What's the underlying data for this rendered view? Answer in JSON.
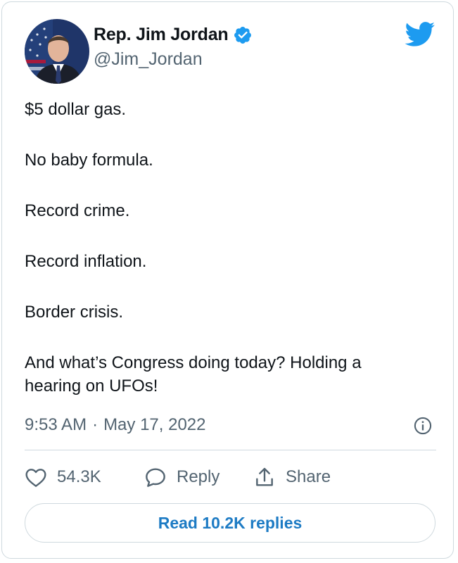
{
  "colors": {
    "brand_blue": "#1d9bf0",
    "link_blue": "#1d7bc4",
    "text_primary": "#0f1419",
    "text_secondary": "#536471",
    "border": "#cfd9de"
  },
  "author": {
    "display_name": "Rep. Jim Jordan",
    "handle": "@Jim_Jordan",
    "verified": true,
    "avatar_icon": "profile-photo",
    "verified_icon": "verified-badge-icon"
  },
  "brand": {
    "logo_icon": "twitter-bird-icon"
  },
  "tweet": {
    "paragraphs": [
      "$5 dollar gas.",
      "No baby formula.",
      "Record crime.",
      "Record inflation.",
      "Border crisis.",
      "And what’s Congress doing today? Holding a hearing on UFOs!"
    ],
    "time": "9:53 AM",
    "separator": "·",
    "date": "May 17, 2022",
    "info_icon": "info-icon"
  },
  "actions": {
    "likes": {
      "icon": "heart-icon",
      "count": "54.3K"
    },
    "reply": {
      "icon": "reply-bubble-icon",
      "label": "Reply"
    },
    "share": {
      "icon": "share-upload-icon",
      "label": "Share"
    }
  },
  "read_replies_label": "Read 10.2K replies"
}
